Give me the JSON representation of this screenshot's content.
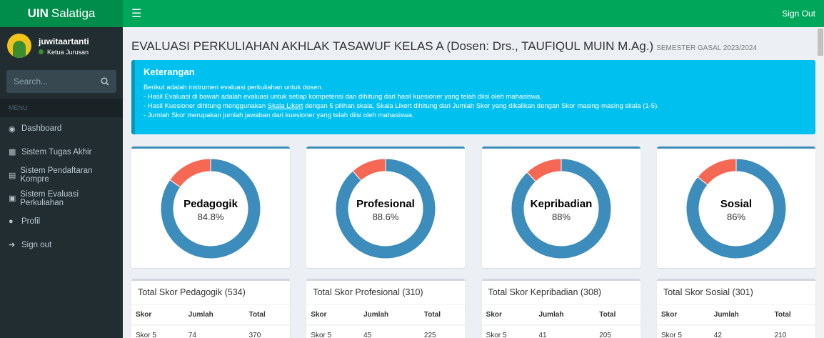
{
  "brand": {
    "bold": "UIN",
    "rest": "Salatiga"
  },
  "topbar": {
    "menu_icon": "hamburger-icon",
    "signout": "Sign Out"
  },
  "user": {
    "name": "juwitaartanti",
    "role": "Ketua Jurusan"
  },
  "search": {
    "placeholder": "Search..."
  },
  "menu": {
    "header": "MENU",
    "items": [
      {
        "label": "Dashboard",
        "icon": "dashboard-icon"
      },
      {
        "label": "Sistem Tugas Akhir",
        "icon": "grid-icon"
      },
      {
        "label": "Sistem Pendaftaran Kompre",
        "icon": "institution-icon"
      },
      {
        "label": "Sistem Evaluasi Perkuliahan",
        "icon": "document-icon"
      },
      {
        "label": "Profil",
        "icon": "user-icon"
      },
      {
        "label": "Sign out",
        "icon": "sign-out-icon"
      }
    ]
  },
  "page": {
    "title": "EVALUASI PERKULIAHAN AKHLAK TASAWUF KELAS A (Dosen: Drs., TAUFIQUL MUIN M.Ag.)",
    "subtitle": "SEMESTER GASAL 2023/2024"
  },
  "callout": {
    "title": "Keterangan",
    "line1": "Berikut adalah instrumen evaluasi perkuliahan untuk dosen.",
    "line2": "- Hasil Evaluasi di bawah adalah evaluasi untuk setiap kompetensi dan dihitung dari hasil kuesioner yang telah diisi oleh mahasiswa.",
    "line3_a": "- Hasil Kuesioner dihitung menggunakan ",
    "line3_link": "Skala Likert",
    "line3_b": " dengan 5 pilihan skala, Skala Likert dihitung dari Jumlah Skor yang dikalikan dengan Skor masing-masing skala (1-5).",
    "line4": "- Jumlah Skor merupakan jumlah jawaban dari kuesioner yang telah diisi oleh mahasiswa."
  },
  "colors": {
    "primary": "#3c8dbc",
    "remainder": "#f56954",
    "accent": "#00a65a"
  },
  "chart_data": [
    {
      "type": "pie",
      "label": "Pedagogik",
      "display": "84.8%",
      "value": 84.8
    },
    {
      "type": "pie",
      "label": "Profesional",
      "display": "88.6%",
      "value": 88.6
    },
    {
      "type": "pie",
      "label": "Kepribadian",
      "display": "88%",
      "value": 88
    },
    {
      "type": "pie",
      "label": "Sosial",
      "display": "86%",
      "value": 86
    }
  ],
  "tables": {
    "headers": [
      "Skor",
      "Jumlah",
      "Total"
    ],
    "items": [
      {
        "title": "Total Skor Pedagogik (534)",
        "rows": [
          [
            "Skor 5",
            "74",
            "370"
          ]
        ]
      },
      {
        "title": "Total Skor Profesional (310)",
        "rows": [
          [
            "Skor 5",
            "45",
            "225"
          ]
        ]
      },
      {
        "title": "Total Skor Kepribadian (308)",
        "rows": [
          [
            "Skor 5",
            "41",
            "205"
          ]
        ]
      },
      {
        "title": "Total Skor Sosial (301)",
        "rows": [
          [
            "Skor 5",
            "42",
            "210"
          ]
        ]
      }
    ]
  }
}
